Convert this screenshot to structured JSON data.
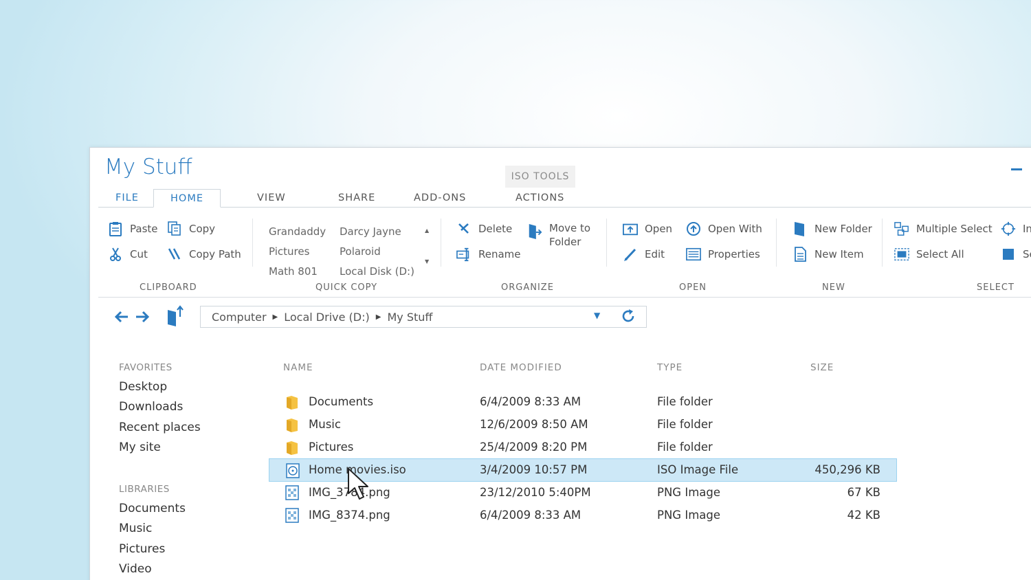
{
  "window": {
    "title": "My Stuff"
  },
  "context_tab": {
    "header": "ISO TOOLS"
  },
  "tabs": [
    {
      "label": "FILE"
    },
    {
      "label": "HOME"
    },
    {
      "label": "VIEW"
    },
    {
      "label": "SHARE"
    },
    {
      "label": "ADD-ONS"
    },
    {
      "label": "ACTIONS"
    }
  ],
  "ribbon": {
    "clipboard": {
      "paste": "Paste",
      "cut": "Cut",
      "copy": "Copy",
      "copy_path": "Copy Path",
      "label": "CLIPBOARD"
    },
    "quick_copy": {
      "items": [
        "Grandaddy",
        "Pictures",
        "Math 801",
        "Darcy Jayne",
        "Polaroid",
        "Local Disk (D:)"
      ],
      "label": "QUICK COPY"
    },
    "organize": {
      "delete": "Delete",
      "rename": "Rename",
      "move_to_folder_1": "Move to",
      "move_to_folder_2": "Folder",
      "label": "ORGANIZE"
    },
    "open": {
      "open": "Open",
      "edit": "Edit",
      "open_with": "Open With",
      "properties": "Properties",
      "label": "OPEN"
    },
    "new": {
      "new_folder": "New Folder",
      "new_item": "New Item",
      "label": "NEW"
    },
    "select": {
      "multiple_select": "Multiple Select",
      "select_all": "Select All",
      "invert_partial": "In",
      "select_partial": "Se",
      "label": "SELECT"
    }
  },
  "address": {
    "crumbs": [
      "Computer",
      "Local Drive (D:)",
      "My Stuff"
    ]
  },
  "sidebar": {
    "favorites_header": "FAVORITES",
    "favorites": [
      "Desktop",
      "Downloads",
      "Recent places",
      "My site"
    ],
    "libraries_header": "LIBRARIES",
    "libraries": [
      "Documents",
      "Music",
      "Pictures",
      "Video"
    ]
  },
  "columns": {
    "name": "NAME",
    "date": "DATE MODIFIED",
    "type": "TYPE",
    "size": "SIZE"
  },
  "files": [
    {
      "name": "Documents",
      "date": "6/4/2009 8:33 AM",
      "type": "File folder",
      "size": "",
      "icon": "folder-icon"
    },
    {
      "name": "Music",
      "date": "12/6/2009 8:50 AM",
      "type": "File folder",
      "size": "",
      "icon": "folder-icon"
    },
    {
      "name": "Pictures",
      "date": "25/4/2009 8:20 PM",
      "type": "File folder",
      "size": "",
      "icon": "folder-icon"
    },
    {
      "name": "Home movies.iso",
      "date": "3/4/2009 10:57 PM",
      "type": "ISO Image File",
      "size": "450,296 KB",
      "icon": "iso-file-icon",
      "selected": true
    },
    {
      "name": "IMG_3784.png",
      "date": "23/12/2010 5:40PM",
      "type": "PNG Image",
      "size": "67 KB",
      "icon": "image-file-icon"
    },
    {
      "name": "IMG_8374.png",
      "date": "6/4/2009 8:33 AM",
      "type": "PNG Image",
      "size": "42 KB",
      "icon": "image-file-icon"
    }
  ],
  "colors": {
    "accent": "#2b7bc0",
    "selection": "#cde8f7",
    "folder": "#f5c242"
  }
}
